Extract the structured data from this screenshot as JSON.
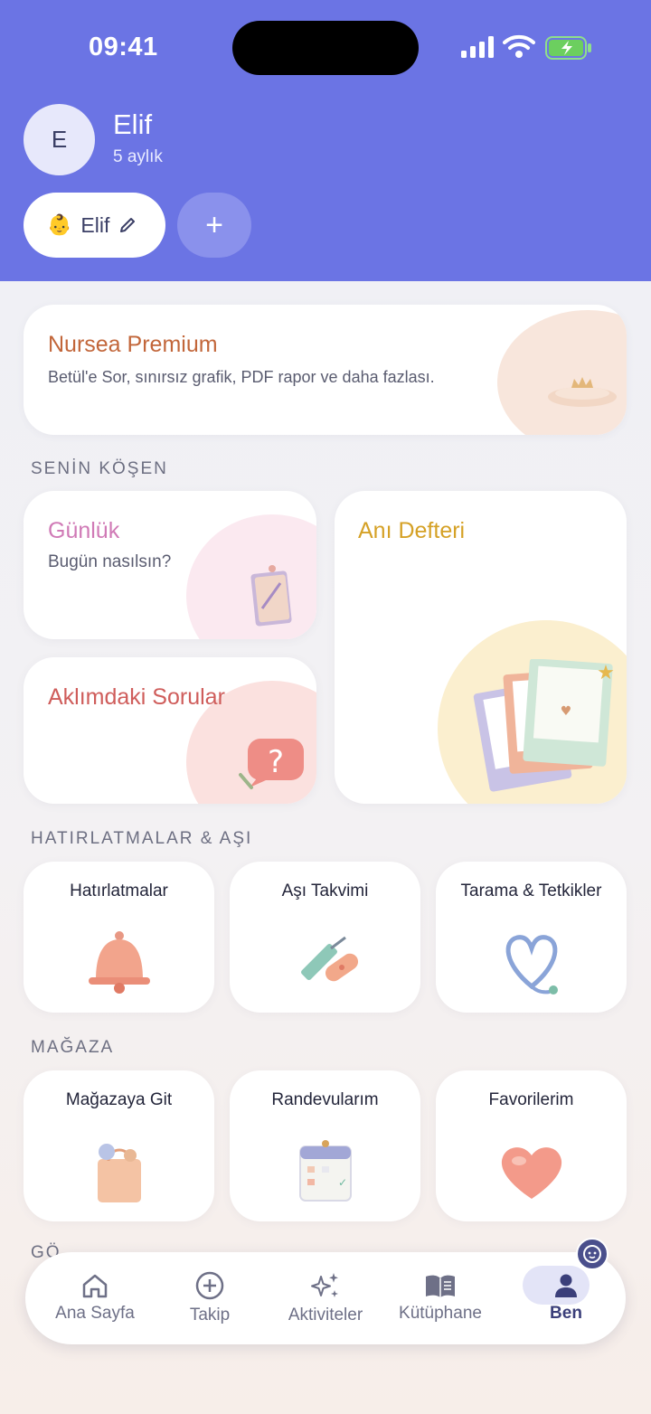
{
  "status_bar": {
    "time": "09:41"
  },
  "profile": {
    "initial": "E",
    "name": "Elif",
    "age": "5 aylık"
  },
  "child_chip": {
    "emoji": "👶",
    "name": "Elif"
  },
  "add_child": {
    "label": "+"
  },
  "premium": {
    "title": "Nursea Premium",
    "subtitle": "Betül'e Sor, sınırsız grafik, PDF rapor ve daha fazlası."
  },
  "sections": {
    "corner": "SENİN KÖŞEN",
    "reminders": "HATIRLATMALAR & AŞI",
    "store": "MAĞAZA",
    "partial": "GÖ"
  },
  "corner_cards": {
    "diary_title": "Günlük",
    "diary_subtitle": "Bugün nasılsın?",
    "questions_title": "Aklımdaki Sorular",
    "memory_title": "Anı Defteri"
  },
  "reminder_tiles": [
    "Hatırlatmalar",
    "Aşı Takvimi",
    "Tarama & Tetkikler"
  ],
  "store_tiles": [
    "Mağazaya Git",
    "Randevularım",
    "Favorilerim"
  ],
  "nav": {
    "items": [
      "Ana Sayfa",
      "Takip",
      "Aktiviteler",
      "Kütüphane",
      "Ben"
    ],
    "active": "Ben"
  },
  "colors": {
    "header": "#6b74e4",
    "premium": "#c2663a",
    "diary": "#d07ab6",
    "questions": "#cf5d5b",
    "memory": "#d5a126"
  }
}
